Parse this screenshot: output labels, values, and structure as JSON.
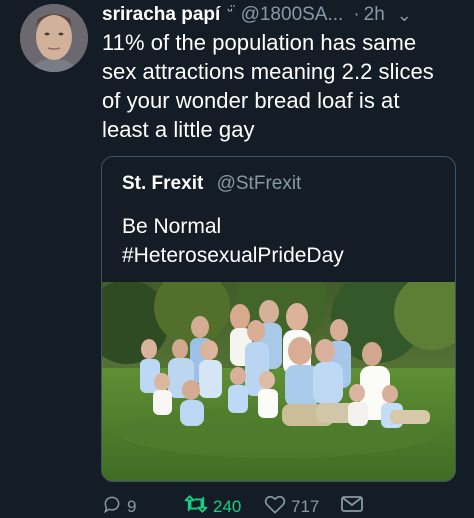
{
  "tweet": {
    "display_name": "sriracha papí",
    "name_emoji": "ᵕ̈",
    "handle": "@1800SA...",
    "separator": "·",
    "time": "2h",
    "caret": "⌄",
    "text": "11% of the population has same\nsex attractions meaning 2.2 slices\nof your wonder bread loaf is at\nleast a little gay"
  },
  "quoted_tweet": {
    "display_name": "St. Frexit",
    "handle": "@StFrexit",
    "text": "Be Normal\n#HeterosexualPrideDay"
  },
  "actions": {
    "reply_count": "9",
    "retweet_count": "240",
    "like_count": "717"
  },
  "colors": {
    "background": "#141d26",
    "secondary_text": "#8899a6",
    "retweet_active": "#19cf86",
    "border": "#3d5466"
  },
  "icons": [
    "reply-icon",
    "retweet-icon",
    "heart-icon",
    "envelope-icon",
    "chevron-down-icon"
  ]
}
